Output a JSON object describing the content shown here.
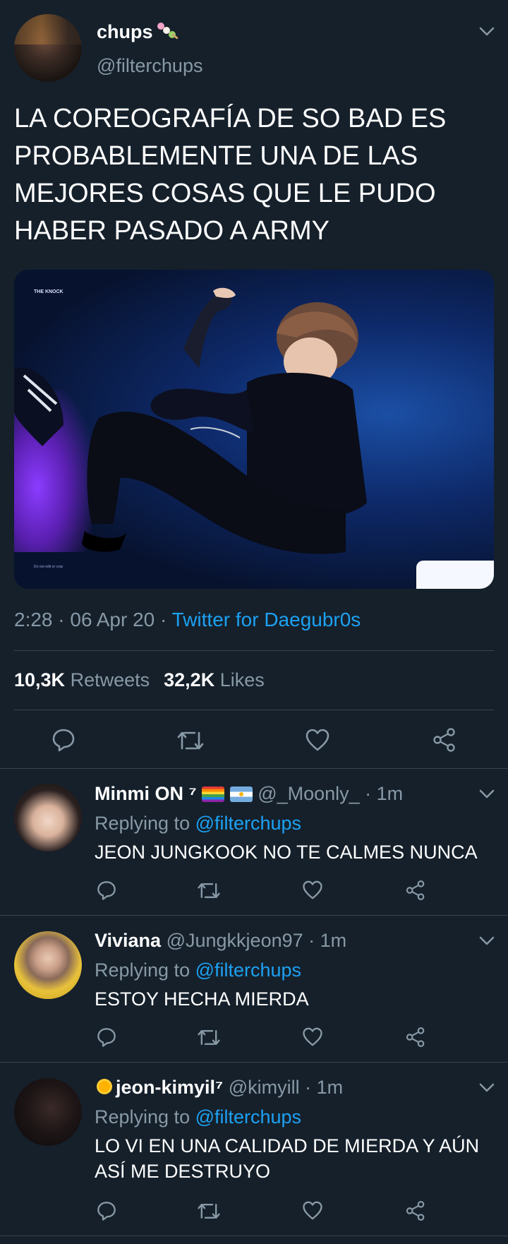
{
  "main_tweet": {
    "display_name": "chups",
    "name_emoji": "dango-icon",
    "handle": "@filterchups",
    "text": "LA COREOGRAFÍA DE SO BAD ES PROBABLEMENTE UNA DE LAS MEJORES COSAS QUE LE PUDO HABER PASADO A ARMY",
    "photo": {
      "watermark": "THE KNOCK",
      "credit": "Do not edit or crop"
    },
    "time": "2:28 · 06 Apr 20 · ",
    "source": "Twitter for Daegubr0s",
    "retweets_count": "10,3K",
    "retweets_label": "Retweets",
    "likes_count": "32,2K",
    "likes_label": "Likes"
  },
  "replies": [
    {
      "name": "Minmi ON ⁷",
      "emojis": [
        "rainbow-icon",
        "argentina-flag-icon"
      ],
      "handle": "@_Moonly_",
      "time": " · 1m",
      "replying_label": "Replying to ",
      "replying_to": "@filterchups",
      "text": "JEON JUNGKOOK NO TE CALMES NUNCA"
    },
    {
      "name": "Viviana",
      "handle": "@Jungkkjeon97",
      "time": " · 1m",
      "replying_label": "Replying to ",
      "replying_to": "@filterchups",
      "text": "ESTOY HECHA MIERDA"
    },
    {
      "name": "jeon-kimyil⁷",
      "name_emoji": "sun-icon",
      "handle": "@kimyill",
      "time": " · 1m",
      "replying_label": "Replying to ",
      "replying_to": "@filterchups",
      "text": "LO VI EN UNA CALIDAD DE MIERDA Y AÚN ASÍ ME DESTRUYO"
    }
  ],
  "colors": {
    "background": "#15202b",
    "secondary_text": "#8899a6",
    "link": "#1da1f2",
    "divider": "#38444d"
  }
}
